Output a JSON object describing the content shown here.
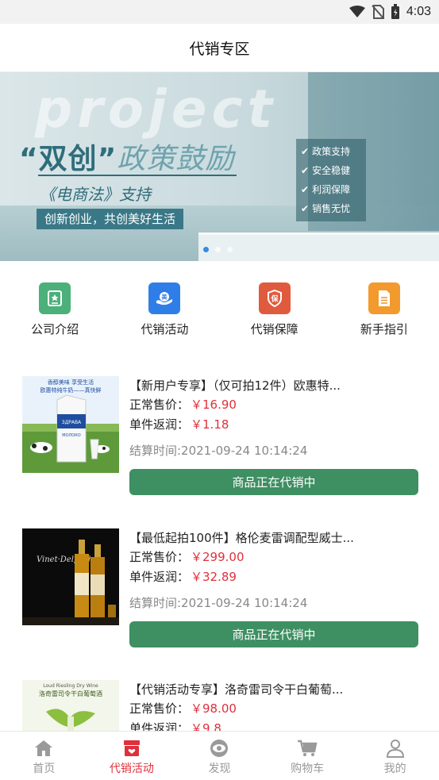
{
  "status_bar": {
    "time": "4:03"
  },
  "header": {
    "title": "代销专区"
  },
  "banner": {
    "watermark": "project",
    "headline_quoted": "“双创”",
    "headline_rest": "政策鼓励",
    "law_line": "《电商法》支持",
    "slogan": "创新创业，共创美好生活",
    "bullets": [
      "政策支持",
      "安全稳健",
      "利润保障",
      "销售无忧"
    ],
    "active_slide": 1,
    "slide_count": 3
  },
  "quick_nav": [
    {
      "label": "公司介绍",
      "icon": "company-icon",
      "color": "#4bb07a"
    },
    {
      "label": "代销活动",
      "icon": "activity-icon",
      "color": "#2f7ee8"
    },
    {
      "label": "代销保障",
      "icon": "shield-icon",
      "color": "#e05a3e"
    },
    {
      "label": "新手指引",
      "icon": "guide-icon",
      "color": "#f29a2e"
    }
  ],
  "labels": {
    "normal_price": "正常售价：",
    "rebate": "单件返润：",
    "status_button": "商品正在代销中"
  },
  "products": [
    {
      "title": "【新用户专享】（仅可拍12件）欧惠特...",
      "price": "￥16.90",
      "rebate": "￥1.18",
      "settle_time": "结算时间:2021-09-24 10:14:24",
      "image": "milk-product-image"
    },
    {
      "title": "【最低起拍100件】格伦麦雷调配型威士...",
      "price": "￥299.00",
      "rebate": "￥32.89",
      "settle_time": "结算时间:2021-09-24 10:14:24",
      "image": "whisky-product-image"
    },
    {
      "title": "【代销活动专享】洛奇雷司令干白葡萄...",
      "price": "￥98.00",
      "rebate": "￥9.8",
      "image": "wine-product-image"
    }
  ],
  "product_images": {
    "milk_caption_1": "香醇美味 享受生活",
    "milk_caption_2": "欧惠特纯牛奶——真快鲜",
    "milk_brand": "ЗДРАВА",
    "milk_label": "МОЛОКО",
    "whisky_brand": "Vinet·Delpech",
    "wine_caption_1": "Loud Riesling Dry Wine",
    "wine_caption_2": "洛奇雷司令干白葡萄酒"
  },
  "tabbar": [
    {
      "label": "首页",
      "icon": "home-icon",
      "active": false
    },
    {
      "label": "代销活动",
      "icon": "shop-icon",
      "active": true
    },
    {
      "label": "发现",
      "icon": "eye-icon",
      "active": false
    },
    {
      "label": "购物车",
      "icon": "cart-icon",
      "active": false
    },
    {
      "label": "我的",
      "icon": "user-icon",
      "active": false
    }
  ],
  "colors": {
    "accent": "#e0303b",
    "button": "#3e8f62",
    "inactive_tab": "#999999"
  }
}
